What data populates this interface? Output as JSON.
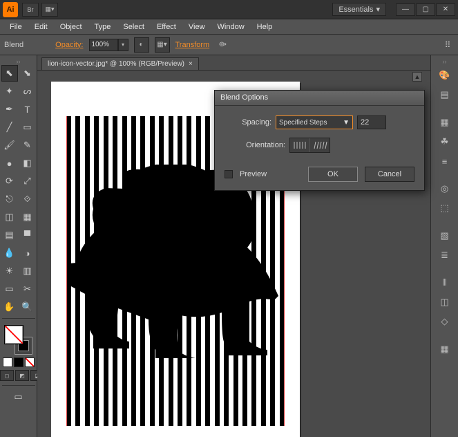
{
  "app": {
    "icon_label": "Ai"
  },
  "workspace": {
    "label": "Essentials"
  },
  "window_controls": {
    "min": "—",
    "max": "▢",
    "close": "✕"
  },
  "menu": {
    "file": "File",
    "edit": "Edit",
    "object": "Object",
    "type": "Type",
    "select": "Select",
    "effect": "Effect",
    "view": "View",
    "window": "Window",
    "help": "Help"
  },
  "control": {
    "tool_label": "Blend",
    "opacity_label": "Opacity:",
    "opacity_value": "100%",
    "transform_label": "Transform"
  },
  "document": {
    "tab_title": "lion-icon-vector.jpg* @ 100% (RGB/Preview)",
    "tab_close": "×"
  },
  "dialog": {
    "title": "Blend Options",
    "spacing_label": "Spacing:",
    "spacing_value": "Specified Steps",
    "spacing_steps": "22",
    "orientation_label": "Orientation:",
    "preview_label": "Preview",
    "ok": "OK",
    "cancel": "Cancel"
  },
  "tools": {
    "selection": "⬉",
    "direct": "⬊",
    "wand": "✦",
    "lasso": "ᔕ",
    "pen": "✒",
    "type": "T",
    "line": "╱",
    "rect": "▭",
    "brush": "🖌",
    "pencil": "✎",
    "blob": "●",
    "eraser": "◧",
    "rotate": "⟳",
    "scale": "⤢",
    "width": "⎋",
    "free": "⟐",
    "shapebuilder": "◫",
    "perspective": "▦",
    "mesh": "▤",
    "gradient": "▀",
    "eyedrop": "💧",
    "blend": "◑",
    "symbol": "☀",
    "graph": "▥",
    "artboard": "▭",
    "slice": "✂",
    "hand": "✋",
    "zoom": "🔍"
  },
  "panels": {
    "color": "🎨",
    "swatches": "▤",
    "brushes": "▦",
    "symbols": "☘",
    "stroke": "≡",
    "appearance": "◎",
    "graphicstyles": "⬚",
    "transparency": "▧",
    "layers": "≣",
    "align": "⫴",
    "pathfinder": "◫",
    "transform": "◇",
    "actions": "▦"
  }
}
